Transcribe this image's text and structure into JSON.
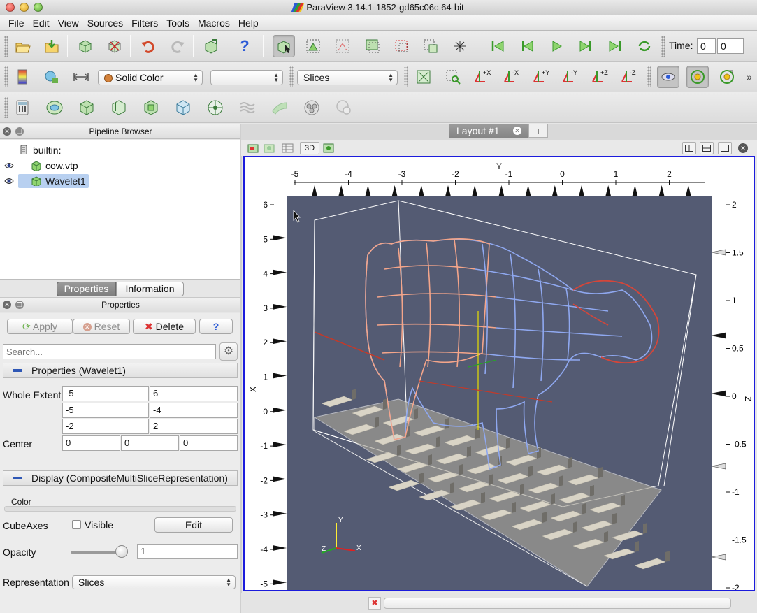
{
  "window": {
    "title": "ParaView 3.14.1-1852-gd65c06c 64-bit"
  },
  "menu": [
    "File",
    "Edit",
    "View",
    "Sources",
    "Filters",
    "Tools",
    "Macros",
    "Help"
  ],
  "toolbar": {
    "time_label": "Time:",
    "time_value": "0",
    "time_step": "0",
    "color_by": "Solid Color",
    "component": "",
    "representation": "Slices"
  },
  "pipeline": {
    "header": "Pipeline Browser",
    "root": "builtin:",
    "items": [
      {
        "label": "cow.vtp",
        "visible": true
      },
      {
        "label": "Wavelet1",
        "visible": true,
        "selected": true
      }
    ]
  },
  "properties": {
    "tab_properties": "Properties",
    "tab_information": "Information",
    "header": "Properties",
    "apply": "Apply",
    "reset": "Reset",
    "delete": "Delete",
    "help": "?",
    "search_placeholder": "Search...",
    "section_properties": "Properties (Wavelet1)",
    "whole_extent_label": "Whole Extent",
    "whole_extent": [
      [
        "-5",
        "6"
      ],
      [
        "-5",
        "-4"
      ],
      [
        "-2",
        "2"
      ]
    ],
    "center_label": "Center",
    "center": [
      "0",
      "0",
      "0"
    ],
    "section_display": "Display (CompositeMultiSliceRepresentation)",
    "color_label": "Color",
    "cube_axes_label": "CubeAxes",
    "cube_axes_visible_label": "Visible",
    "cube_axes_visible": false,
    "edit": "Edit",
    "opacity_label": "Opacity",
    "opacity": "1",
    "representation_label": "Representation",
    "representation": "Slices"
  },
  "layout": {
    "tab_label": "Layout #1",
    "add": "+",
    "view_mode": "3D"
  },
  "view": {
    "background": "#545b73",
    "y_axis_title": "Y",
    "x_axis_title": "X",
    "z_axis_title": "Z",
    "top_ticks": [
      "-5",
      "-4",
      "-3",
      "-2",
      "-1",
      "0",
      "1",
      "2"
    ],
    "left_ticks": [
      "6",
      "5",
      "4",
      "3",
      "2",
      "1",
      "0",
      "-1",
      "-2",
      "-3",
      "-4",
      "-5"
    ],
    "right_ticks": [
      "2",
      "1.5",
      "1",
      "0.5",
      "0",
      "-0.5",
      "-1",
      "-1.5",
      "-2"
    ],
    "orientation": {
      "x": "X",
      "y": "Y",
      "z": "Z"
    }
  },
  "colors": {
    "accent": "#1b1bdc",
    "selection": "#b8d0f0",
    "cow_warm": "#f4a58a",
    "cow_cool": "#8fa8f0"
  }
}
